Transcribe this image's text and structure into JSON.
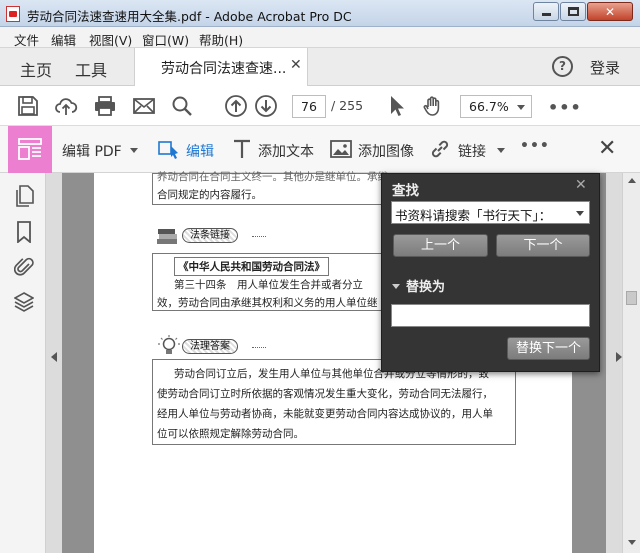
{
  "window": {
    "title": "劳动合同法速查速用大全集.pdf - Adobe Acrobat Pro DC"
  },
  "menu": [
    "文件",
    "编辑",
    "视图(V)",
    "窗口(W)",
    "帮助(H)"
  ],
  "tabs": {
    "home": "主页",
    "tools": "工具",
    "document": "劳动合同法速查速...",
    "login": "登录"
  },
  "toolbar": {
    "current_page": "76",
    "total_pages": "/ 255",
    "zoom": "66.7%"
  },
  "edit_toolbar": {
    "edit_pdf": "编辑 PDF",
    "edit": "编辑",
    "add_text": "添加文本",
    "add_image": "添加图像",
    "link": "链接"
  },
  "find_panel": {
    "title": "查找",
    "search_value": "书资料请搜索「书行天下」：",
    "prev": "上一个",
    "next": "下一个",
    "replace_heading": "替换为",
    "replace_value": "",
    "replace_next": "替换下一个"
  },
  "document": {
    "top_line1": "养动合同在合同主义终一。其他办是继单位。承继",
    "top_line2": "合同规定的内容履行。",
    "badge_links": "法条链接",
    "law_title": "《中华人民共和国劳动合同法》",
    "article_line1": "第三十四条　用人单位发生合并或者分立",
    "article_line2": "效，劳动合同由承继其权利和义务的用人单位继",
    "badge_answer": "法理答案",
    "answer_line1": "劳动合同订立后，发生用人单位与其他单位合并或分立等情形的，致",
    "answer_line2": "使劳动合同订立时所依据的客观情况发生重大变化，劳动合同无法履行，",
    "answer_line3": "经用人单位与劳动者协商，未能就变更劳动合同内容达成协议的，用人单",
    "answer_line4": "位可以依照规定解除劳动合同。"
  },
  "colors": {
    "accent_blue": "#1f78d1",
    "edit_tool_pink": "#ec7fd0",
    "find_panel_bg": "#343434"
  }
}
